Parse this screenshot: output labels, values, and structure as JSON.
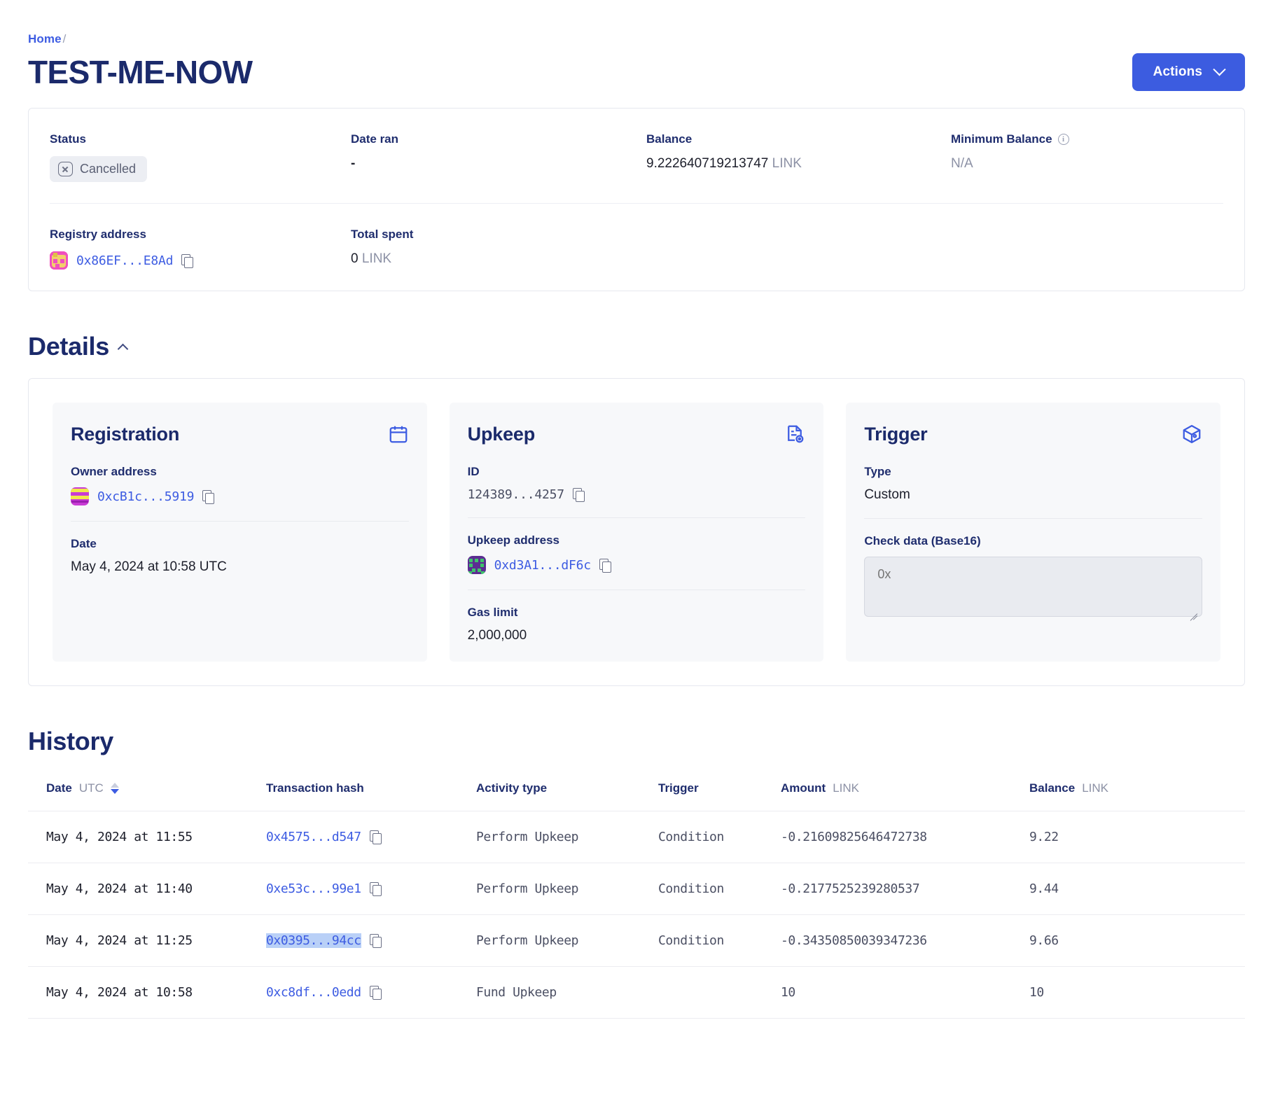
{
  "breadcrumb": {
    "home": "Home",
    "separator": "/"
  },
  "header": {
    "title": "TEST-ME-NOW",
    "actions_label": "Actions"
  },
  "summary": {
    "status": {
      "label": "Status",
      "value": "Cancelled",
      "icon": "cancel-octagon-icon"
    },
    "date_ran": {
      "label": "Date ran",
      "value": "-"
    },
    "balance": {
      "label": "Balance",
      "value": "9.222640719213747",
      "unit": "LINK"
    },
    "minimum_balance": {
      "label": "Minimum Balance",
      "value": "N/A",
      "icon": "info-icon"
    },
    "registry_address": {
      "label": "Registry address",
      "value": "0x86EF...E8Ad"
    },
    "total_spent": {
      "label": "Total spent",
      "value": "0",
      "unit": "LINK"
    }
  },
  "details": {
    "heading": "Details",
    "registration": {
      "title": "Registration",
      "icon": "calendar-icon",
      "owner_label": "Owner address",
      "owner_value": "0xcB1c...5919",
      "date_label": "Date",
      "date_value": "May 4, 2024 at 10:58 UTC"
    },
    "upkeep": {
      "title": "Upkeep",
      "icon": "document-check-icon",
      "id_label": "ID",
      "id_value": "124389...4257",
      "address_label": "Upkeep address",
      "address_value": "0xd3A1...dF6c",
      "gas_label": "Gas limit",
      "gas_value": "2,000,000"
    },
    "trigger": {
      "title": "Trigger",
      "icon": "cube-icon",
      "type_label": "Type",
      "type_value": "Custom",
      "checkdata_label": "Check data (Base16)",
      "checkdata_placeholder": "0x",
      "checkdata_value": ""
    }
  },
  "history": {
    "heading": "History",
    "columns": {
      "date": "Date",
      "date_unit": "UTC",
      "hash": "Transaction hash",
      "activity": "Activity type",
      "trigger": "Trigger",
      "amount": "Amount",
      "amount_unit": "LINK",
      "balance": "Balance",
      "balance_unit": "LINK"
    },
    "rows": [
      {
        "date": "May 4, 2024 at 11:55",
        "hash": "0x4575...d547",
        "activity": "Perform Upkeep",
        "trigger": "Condition",
        "amount": "-0.21609825646472738",
        "balance": "9.22",
        "selected": false
      },
      {
        "date": "May 4, 2024 at 11:40",
        "hash": "0xe53c...99e1",
        "activity": "Perform Upkeep",
        "trigger": "Condition",
        "amount": "-0.2177525239280537",
        "balance": "9.44",
        "selected": false
      },
      {
        "date": "May 4, 2024 at 11:25",
        "hash": "0x0395...94cc",
        "activity": "Perform Upkeep",
        "trigger": "Condition",
        "amount": "-0.34350850039347236",
        "balance": "9.66",
        "selected": true
      },
      {
        "date": "May 4, 2024 at 10:58",
        "hash": "0xc8df...0edd",
        "activity": "Fund Upkeep",
        "trigger": "",
        "amount": "10",
        "balance": "10",
        "selected": false
      }
    ]
  },
  "colors": {
    "accent": "#3c5ce0",
    "title": "#1b2a6b",
    "muted": "#8c91a5",
    "panel_bg": "#f7f8fa"
  }
}
